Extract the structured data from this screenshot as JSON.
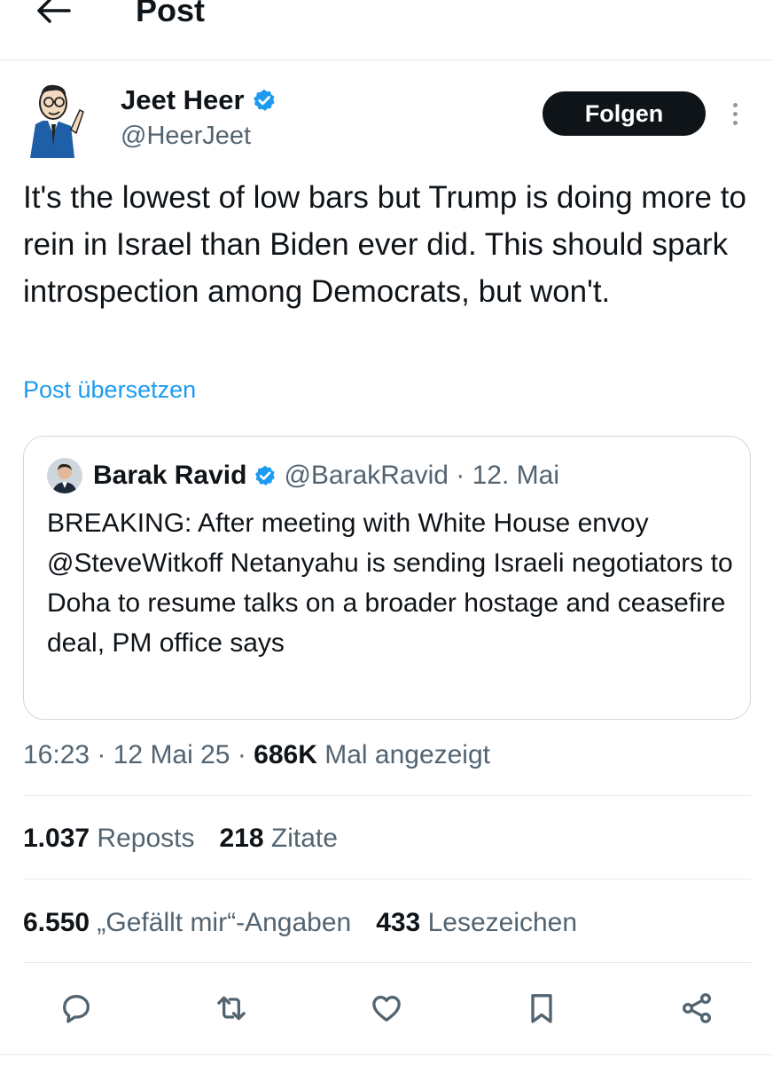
{
  "header": {
    "back_icon": "arrow-left-icon",
    "title": "Post"
  },
  "author": {
    "name": "Jeet Heer",
    "handle": "@HeerJeet",
    "verified_icon": "verified-badge-icon",
    "follow_label": "Folgen",
    "more_icon": "more-vertical-icon"
  },
  "tweet": {
    "text": "It's the lowest of low bars but Trump is doing more to rein in Israel than Biden ever did. This should spark introspection among Democrats, but won't.",
    "translate_label": "Post übersetzen"
  },
  "quote": {
    "name": "Barak Ravid",
    "handle_date": "@BarakRavid · 12. Mai",
    "text": "BREAKING: After meeting with White House envoy @SteveWitkoff Netanyahu is sending Israeli negotiators to Doha to resume talks on a broader hostage and ceasefire deal, PM office says"
  },
  "meta": {
    "time_date": "16:23 · 12 Mai 25 · ",
    "views_count": "686K",
    "views_label": " Mal angezeigt"
  },
  "stats": {
    "reposts_count": "1.037",
    "reposts_label": " Reposts",
    "quotes_count": "218",
    "quotes_label": " Zitate",
    "likes_count": "6.550",
    "likes_label": " „Gefällt mir“-Angaben",
    "bookmarks_count": "433",
    "bookmarks_label": " Lesezeichen"
  },
  "actions": [
    "reply-icon",
    "repost-icon",
    "like-icon",
    "bookmark-icon",
    "share-icon"
  ],
  "colors": {
    "accent": "#1d9bf0",
    "text": "#0f1419",
    "secondary": "#536471",
    "border": "#cfd9de"
  }
}
